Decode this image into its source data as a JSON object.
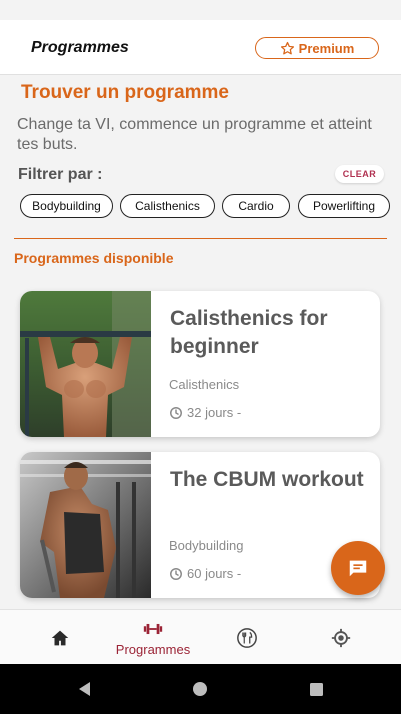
{
  "header": {
    "title": "Programmes",
    "premium_label": "Premium"
  },
  "finder": {
    "title": "Trouver un programme",
    "subtitle": "Change ta VI, commence un programme et atteint tes buts.",
    "filter_label": "Filtrer par :",
    "clear_label": "CLEAR"
  },
  "filters": [
    "Bodybuilding",
    "Calisthenics",
    "Cardio",
    "Powerlifting"
  ],
  "available_title": "Programmes disponible",
  "programs": [
    {
      "name": "Calisthenics for beginner",
      "category": "Calisthenics",
      "duration": "32 jours -"
    },
    {
      "name": "The CBUM workout",
      "category": "Bodybuilding",
      "duration": "60 jours -"
    }
  ],
  "nav": {
    "active_label": "Programmes"
  },
  "colors": {
    "accent": "#d9661a",
    "active_nav": "#9b2436",
    "clear": "#b03050"
  },
  "icons": [
    "star-icon",
    "clock-icon",
    "chat-icon",
    "home-icon",
    "dumbbell-icon",
    "nutrition-icon",
    "location-icon",
    "back-icon",
    "home-circle-icon",
    "recents-icon"
  ]
}
